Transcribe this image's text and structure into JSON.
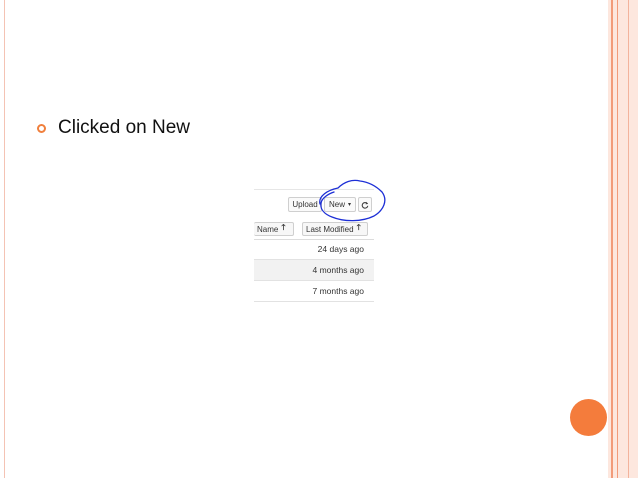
{
  "slide": {
    "bullet_text": "Clicked on New"
  },
  "toolbar": {
    "upload_label": "Upload",
    "new_label": "New",
    "new_caret": "▾",
    "refresh_icon": "refresh-icon"
  },
  "columns": {
    "name_label": "Name",
    "last_modified_label": "Last Modified",
    "sort_arrow": "🡑"
  },
  "files": [
    {
      "modified": "24 days ago"
    },
    {
      "modified": "4 months ago"
    },
    {
      "modified": "7 months ago"
    }
  ],
  "colors": {
    "accent": "#f47c3c",
    "annotation": "#1d2fd6"
  }
}
